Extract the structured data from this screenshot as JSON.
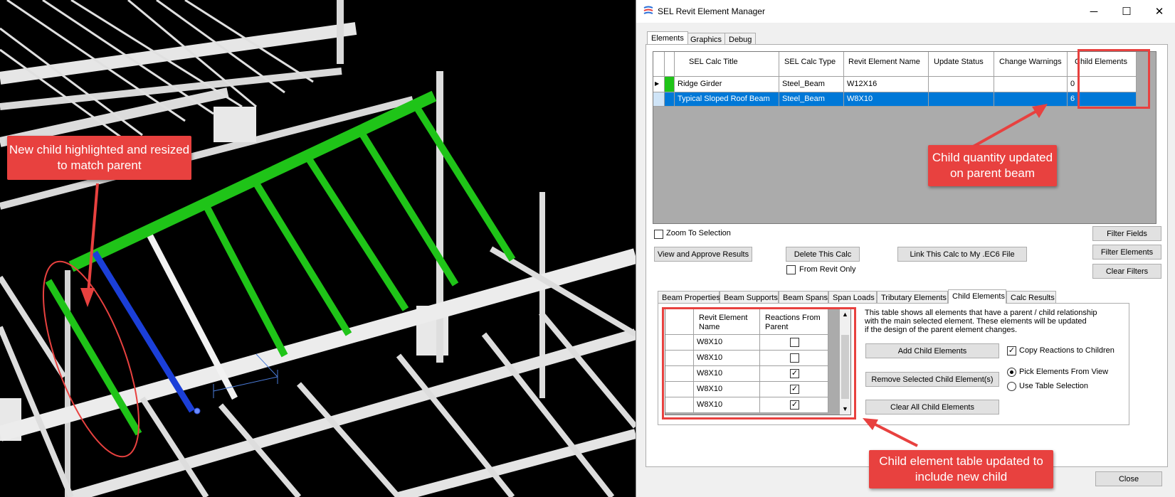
{
  "viewport": {
    "callout_text": "New child highlighted and resized to match parent"
  },
  "window": {
    "title": "SEL Revit Element Manager",
    "minimize": "─",
    "maximize": "☐",
    "close": "✕",
    "tabs": [
      "Elements",
      "Graphics",
      "Debug"
    ],
    "main_grid": {
      "headers": [
        "",
        "",
        "SEL Calc Title",
        "SEL Calc Type",
        "Revit Element Name",
        "Update Status",
        "Change Warnings",
        "Child Elements"
      ],
      "rows": [
        {
          "marker": "▶",
          "title": "Ridge Girder",
          "type": "Steel_Beam",
          "name": "W12X16",
          "status": "",
          "warnings": "",
          "children": "0"
        },
        {
          "marker": "",
          "title": "Typical Sloped Roof Beam",
          "type": "Steel_Beam",
          "name": "W8X10",
          "status": "",
          "warnings": "",
          "children": "6"
        }
      ]
    },
    "callout_parent": "Child quantity updated on parent beam",
    "zoom_to_selection": "Zoom To Selection",
    "buttons": {
      "view_approve": "View and Approve Results",
      "delete_calc": "Delete This Calc",
      "link_calc": "Link This Calc to My .EC6 File",
      "filter_fields": "Filter Fields",
      "filter_elements": "Filter Elements",
      "clear_filters": "Clear Filters",
      "add_child": "Add Child Elements",
      "remove_child": "Remove Selected Child Element(s)",
      "clear_child": "Clear All Child Elements",
      "close": "Close"
    },
    "from_revit_only": "From Revit Only",
    "sub_tabs": [
      "Beam Properties",
      "Beam Supports",
      "Beam Spans",
      "Span Loads",
      "Tributary Elements",
      "Child Elements",
      "Calc Results"
    ],
    "child_grid": {
      "headers": [
        "",
        "Revit Element Name",
        "Reactions From Parent"
      ],
      "rows": [
        {
          "name": "W8X10",
          "checked": false
        },
        {
          "name": "W8X10",
          "checked": false
        },
        {
          "name": "W8X10",
          "checked": true
        },
        {
          "name": "W8X10",
          "checked": true
        },
        {
          "name": "W8X10",
          "checked": true
        }
      ]
    },
    "description": [
      "This table shows all elements that have a parent / child relationship",
      "with the main selected element.  These elements will be updated",
      "if the design of the parent element changes."
    ],
    "copy_reactions": "Copy Reactions to Children",
    "pick_from_view": "Pick Elements From View",
    "use_table_selection": "Use Table Selection",
    "callout_child": "Child element table updated to include new child",
    "colors": {
      "accent": "#e8413f",
      "selected_row": "#0078d7",
      "green": "#1fc418",
      "blue": "#1b3fd8"
    }
  }
}
